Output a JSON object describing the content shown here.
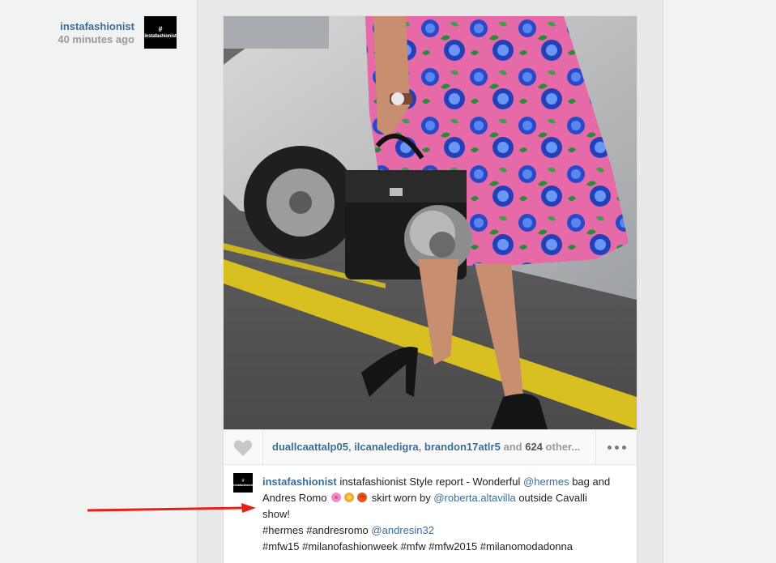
{
  "post": {
    "author": "instafashionist",
    "time": "40 minutes ago",
    "avatar_text": "instafashionist",
    "avatar_hash": "#"
  },
  "likes": {
    "users": [
      "duallcaattalp05",
      "ilcanaledigra",
      "brandon17atlr5"
    ],
    "separator": ",",
    "and": "and",
    "count": "624",
    "others": "other..."
  },
  "caption": {
    "user": "instafashionist",
    "line1_text": "instafashionist Style report - Wonderful",
    "mention_hermes": "@hermes",
    "line1_end": "bag and",
    "line2_start": "Andres Romo",
    "line2_mid": "skirt worn by",
    "mention_roberta": "@roberta.altavilla",
    "line2_end": "outside Cavalli",
    "line3": "show!",
    "line4_tags": "#hermes #andresromo",
    "mention_andresin": "@andresin32",
    "line5_tags": "#mfw15 #milanofashionweek #mfw #mfw2015 #milanomodadonna"
  },
  "icons": {
    "heart": "heart-icon",
    "more": "more-options-icon",
    "arrow": "red-arrow-annotation"
  },
  "colors": {
    "link": "#3b6d99",
    "annotation": "#e8201c"
  }
}
